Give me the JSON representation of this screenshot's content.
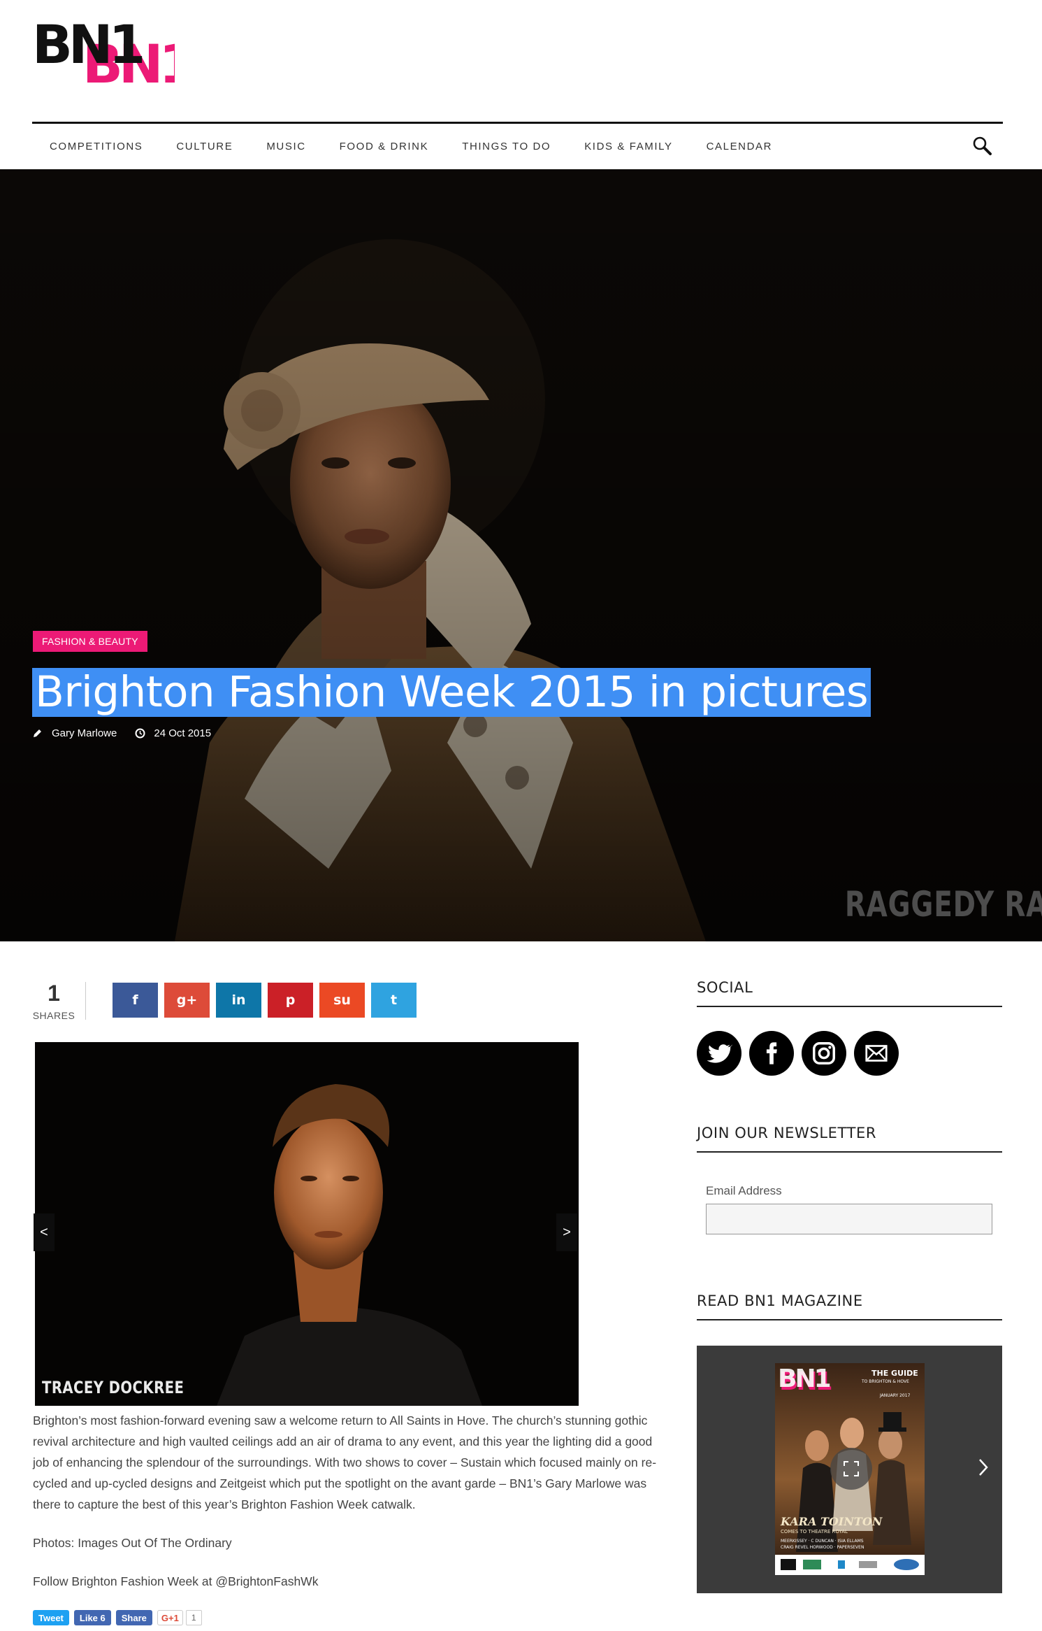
{
  "brand": {
    "logo_text": "BN1",
    "colors": {
      "black": "#111111",
      "pink": "#ec1a76"
    }
  },
  "nav": {
    "items": [
      "COMPETITIONS",
      "CULTURE",
      "MUSIC",
      "FOOD & DRINK",
      "THINGS TO DO",
      "KIDS & FAMILY",
      "CALENDAR"
    ],
    "search_icon": "search-icon"
  },
  "hero": {
    "category": "FASHION & BEAUTY",
    "title": "Brighton Fashion Week 2015 in pictures",
    "author": "Gary Marlowe",
    "date": "24 Oct 2015",
    "watermark": "RAGGEDY RA",
    "colors": {
      "category_bg": "#ec1a76",
      "title_highlight": "#3f8ff4"
    }
  },
  "share": {
    "count": "1",
    "label": "SHARES",
    "buttons": [
      {
        "name": "facebook",
        "glyph": "f",
        "color": "#3b5998"
      },
      {
        "name": "google-plus",
        "glyph": "g+",
        "color": "#dd4b39"
      },
      {
        "name": "linkedin",
        "glyph": "in",
        "color": "#0e76a8"
      },
      {
        "name": "pinterest",
        "glyph": "p",
        "color": "#cb2027"
      },
      {
        "name": "stumbleupon",
        "glyph": "su",
        "color": "#eb4924"
      },
      {
        "name": "twitter",
        "glyph": "t",
        "color": "#2fa3e0"
      }
    ]
  },
  "slider": {
    "credit": "TRACEY DOCKREE",
    "prev": "<",
    "next": ">"
  },
  "article": {
    "paragraphs": [
      "Brighton’s most fashion-forward evening saw a welcome return to All Saints in Hove. The church’s stunning gothic revival architecture and high vaulted ceilings add an air of drama to any event, and this year the lighting did a good job of enhancing the splendour of the surroundings. With two shows to cover – Sustain which focused mainly on re-cycled and up-cycled designs and Zeitgeist which put the spotlight on the avant garde – BN1’s Gary Marlowe was there to capture the best of this year’s Brighton Fashion Week catwalk.",
      "Photos: Images Out Of The Ordinary",
      "Follow Brighton Fashion Week at @BrightonFashWk"
    ]
  },
  "social_buttons": {
    "tweet": "Tweet",
    "like": "Like 6",
    "share": "Share",
    "gplus": "G+1",
    "gplus_count": "1"
  },
  "sidebar": {
    "social_heading": "SOCIAL",
    "newsletter_heading": "JOIN OUR NEWSLETTER",
    "email_label": "Email Address",
    "email_value": "",
    "magazine_heading": "READ BN1 MAGAZINE",
    "magazine": {
      "masthead": "BN1",
      "tagline": "THE GUIDE",
      "tagline2": "TO BRIGHTON & HOVE",
      "issue": "JANUARY 2017",
      "headline": "KARA TOINTON",
      "subhead": "COMES TO THEATRE ROYAL",
      "cover_lines": "MEERKISSEY · C DUNCAN · ISIA ELLAMS",
      "cover_lines2": "CRAIG REVEL HORWOOD · PAPERSEVEN"
    }
  }
}
